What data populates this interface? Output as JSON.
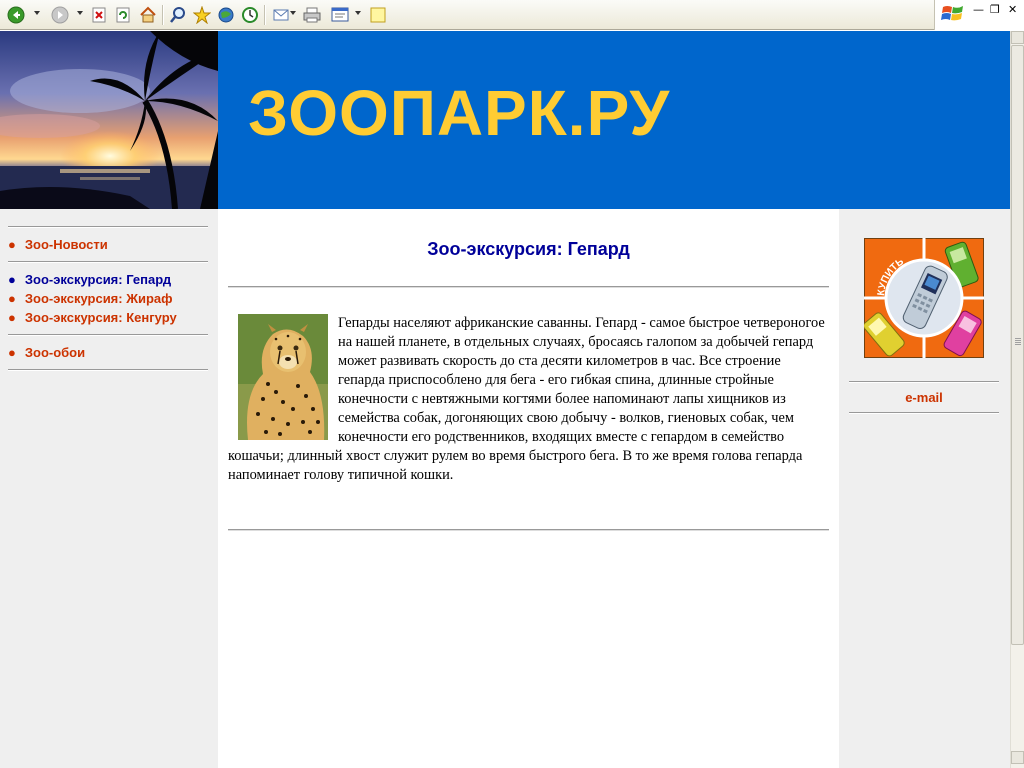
{
  "toolbar": {
    "buttons": [
      "back-icon",
      "forward-icon",
      "stop-icon",
      "refresh-icon",
      "home-icon",
      "search-icon",
      "favorites-icon",
      "media-icon",
      "history-icon",
      "mail-icon",
      "print-icon",
      "edit-icon",
      "discuss-icon"
    ]
  },
  "header": {
    "site_title": "ЗООПАРК.РУ"
  },
  "nav": {
    "items": [
      {
        "label": "Зоо-Новости",
        "active": false
      },
      {
        "label": "Зоо-экскурсия: Гепард",
        "active": true
      },
      {
        "label": "Зоо-экскурсия: Жираф",
        "active": false
      },
      {
        "label": "Зоо-экскурсия: Кенгуру",
        "active": false
      },
      {
        "label": "Зоо-обои",
        "active": false
      }
    ]
  },
  "main": {
    "heading": "Зоо-экскурсия: Гепард",
    "article": "Гепарды населяют африканские саванны. Гепард - самое быстрое четвероногое на нашей планете, в отдельных случаях, бросаясь галопом за добычей гепард может развивать скорость до ста десяти километров в час. Все строение гепарда приспособлено для бега - его гибкая спина, длинные стройные конечности с невтяжными когтями более напоминают лапы хищников из семейства собак, догоняющих свою добычу - волков, гиеновых собак, чем конечности его родственников, входящих вместе с гепардом в семейство кошачьи; длинный хвост служит рулем во время быстрого бега. В то же время голова гепарда напоминает голову типичной кошки."
  },
  "right": {
    "ad_text": "КУПИТЬ",
    "email_label": "e-mail"
  },
  "colors": {
    "banner": "#0066cc",
    "title": "#ffcc33",
    "link": "#cc3300",
    "active_link": "#000099"
  }
}
